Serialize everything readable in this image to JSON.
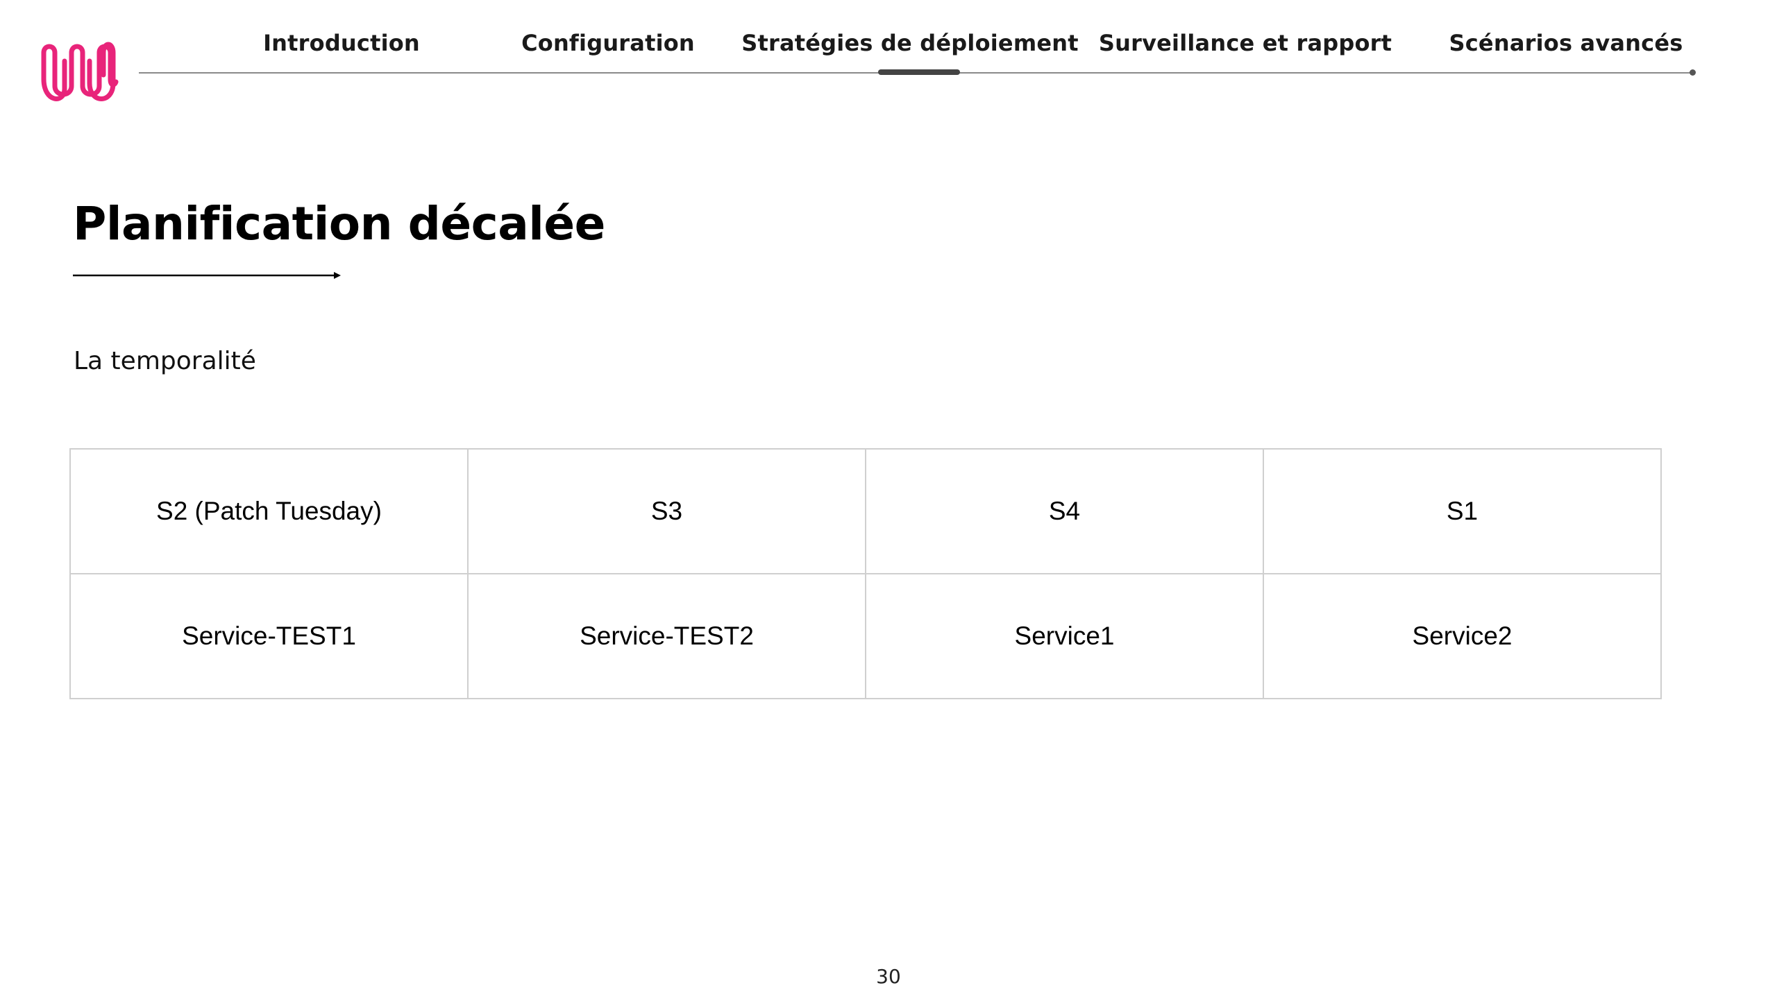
{
  "nav": {
    "items": [
      {
        "label": "Introduction",
        "active": false
      },
      {
        "label": "Configuration",
        "active": false
      },
      {
        "label": "Stratégies de déploiement",
        "active": true
      },
      {
        "label": "Surveillance et rapport",
        "active": false
      },
      {
        "label": "Scénarios avancés",
        "active": false
      }
    ]
  },
  "logo": {
    "icon": "wavy-w-logo",
    "color": "#e8247a"
  },
  "slide": {
    "title": "Planification décalée",
    "subtitle": "La temporalité",
    "page_number": "30"
  },
  "table": {
    "rows": [
      [
        "S2 (Patch Tuesday)",
        "S3",
        "S4",
        "S1"
      ],
      [
        "Service-TEST1",
        "Service-TEST2",
        "Service1",
        "Service2"
      ]
    ]
  }
}
